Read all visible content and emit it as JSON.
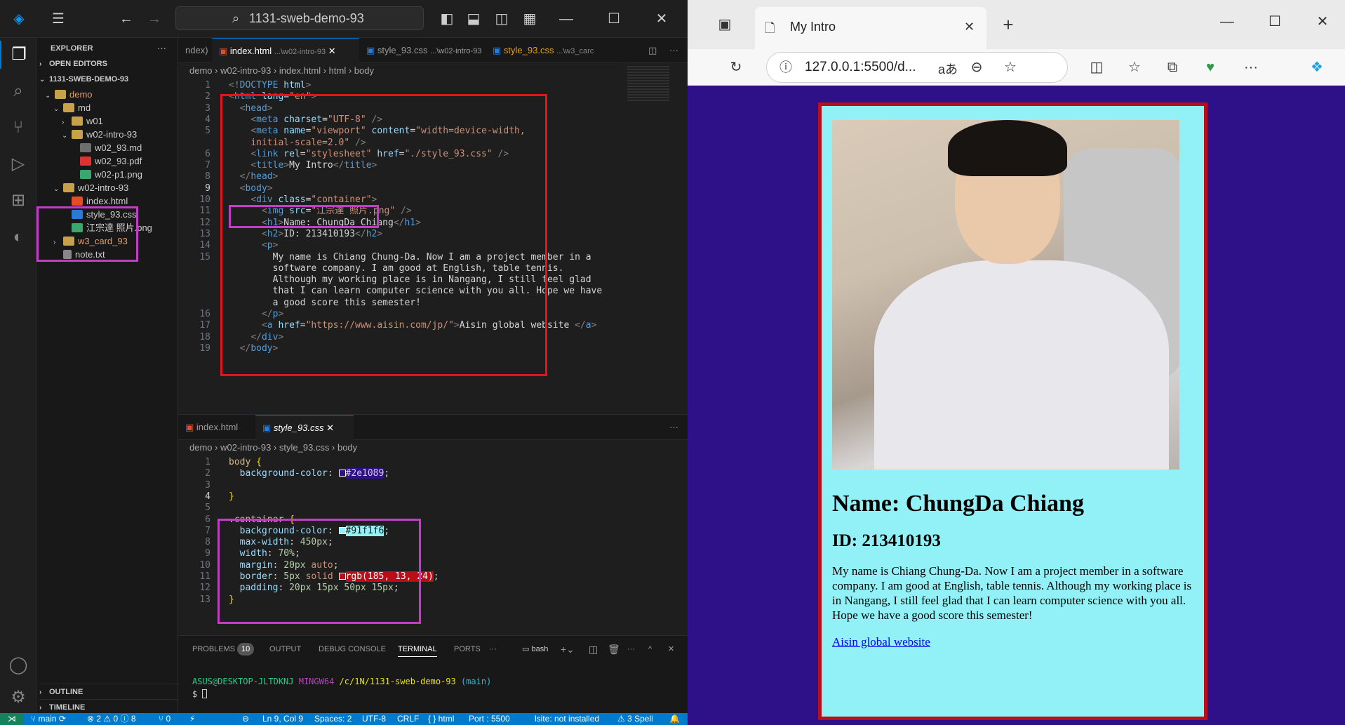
{
  "vscode": {
    "search": "1131-sweb-demo-93",
    "explorer_title": "EXPLORER",
    "open_editors": "OPEN EDITORS",
    "workspace": "1131-SWEB-DEMO-93",
    "tree": [
      {
        "label": "demo",
        "indent": 1,
        "type": "folder",
        "open": true,
        "color": "#e59b6a"
      },
      {
        "label": "md",
        "indent": 2,
        "type": "folder",
        "open": true
      },
      {
        "label": "w01",
        "indent": 3,
        "type": "folder",
        "open": false
      },
      {
        "label": "w02-intro-93",
        "indent": 3,
        "type": "folder",
        "open": true
      },
      {
        "label": "w02_93.md",
        "indent": 4,
        "type": "md"
      },
      {
        "label": "w02_93.pdf",
        "indent": 4,
        "type": "pdf"
      },
      {
        "label": "w02-p1.png",
        "indent": 4,
        "type": "png"
      },
      {
        "label": "w02-intro-93",
        "indent": 2,
        "type": "folder",
        "open": true
      },
      {
        "label": "index.html",
        "indent": 3,
        "type": "html"
      },
      {
        "label": "style_93.css",
        "indent": 3,
        "type": "css"
      },
      {
        "label": "江宗達 照片.png",
        "indent": 3,
        "type": "png"
      },
      {
        "label": "w3_card_93",
        "indent": 2,
        "type": "folder",
        "open": false,
        "color": "#e59b6a"
      },
      {
        "label": "note.txt",
        "indent": 2,
        "type": "txt"
      }
    ],
    "outline": "OUTLINE",
    "timeline": "TIMELINE",
    "editor1_tabs": [
      "ndex)",
      "index.html",
      "...\\w02-intro-93",
      "style_93.css",
      "...\\w02-intro-93",
      "style_93.css",
      "...\\w3_carc"
    ],
    "editor1_crumbs": "demo  ›  w02-intro-93  ›  index.html  ›  html  ›  body",
    "html_lines": [
      {
        "n": "1",
        "h": "<span class='g'>&lt;!</span><span class='t'>DOCTYPE</span> <span class='a'>html</span><span class='g'>&gt;</span>"
      },
      {
        "n": "2",
        "h": "<span class='g'>&lt;</span><span class='t'>html</span> <span class='a'>lang</span>=<span class='s'>\"en\"</span><span class='g'>&gt;</span>"
      },
      {
        "n": "3",
        "h": "  <span class='g'>&lt;</span><span class='t'>head</span><span class='g'>&gt;</span>"
      },
      {
        "n": "4",
        "h": "    <span class='g'>&lt;</span><span class='t'>meta</span> <span class='a'>charset</span>=<span class='s'>\"UTF-8\"</span> <span class='g'>/&gt;</span>"
      },
      {
        "n": "5",
        "h": "    <span class='g'>&lt;</span><span class='t'>meta</span> <span class='a'>name</span>=<span class='s'>\"viewport\"</span> <span class='a'>content</span>=<span class='s'>\"width=device-width,</span>"
      },
      {
        "n": "",
        "h": "    <span class='s'>initial-scale=2.0\"</span> <span class='g'>/&gt;</span>"
      },
      {
        "n": "6",
        "h": "    <span class='g'>&lt;</span><span class='t'>link</span> <span class='a'>rel</span>=<span class='s'>\"stylesheet\"</span> <span class='a'>href</span>=<span class='s'>\"./style_93.css\"</span> <span class='g'>/&gt;</span>"
      },
      {
        "n": "7",
        "h": "    <span class='g'>&lt;</span><span class='t'>title</span><span class='g'>&gt;</span>My Intro<span class='g'>&lt;/</span><span class='t'>title</span><span class='g'>&gt;</span>"
      },
      {
        "n": "8",
        "h": "  <span class='g'>&lt;/</span><span class='t'>head</span><span class='g'>&gt;</span>"
      },
      {
        "n": "9",
        "h": "  <span class='g'>&lt;</span><span class='t'>body</span><span class='g'>&gt;</span>"
      },
      {
        "n": "10",
        "h": "    <span class='g'>&lt;</span><span class='t'>div</span> <span class='a'>class</span>=<span class='s'>\"container\"</span><span class='g'>&gt;</span>"
      },
      {
        "n": "11",
        "h": "      <span class='g'>&lt;</span><span class='t'>img</span> <span class='a'>src</span>=<span class='s'>\"江宗達 照片.png\"</span> <span class='g'>/&gt;</span>"
      },
      {
        "n": "12",
        "h": "      <span class='g'>&lt;</span><span class='t'>h1</span><span class='g'>&gt;</span>Name: ChungDa Chiang<span class='g'>&lt;/</span><span class='t'>h1</span><span class='g'>&gt;</span>"
      },
      {
        "n": "13",
        "h": "      <span class='g'>&lt;</span><span class='t'>h2</span><span class='g'>&gt;</span>ID: 213410193<span class='g'>&lt;/</span><span class='t'>h2</span><span class='g'>&gt;</span>"
      },
      {
        "n": "14",
        "h": "      <span class='g'>&lt;</span><span class='t'>p</span><span class='g'>&gt;</span>"
      },
      {
        "n": "15",
        "h": "        My name is Chiang Chung-Da. Now I am a project member in a"
      },
      {
        "n": "",
        "h": "        software company. I am good at English, table tennis."
      },
      {
        "n": "",
        "h": "        Although my working place is in Nangang, I still feel glad"
      },
      {
        "n": "",
        "h": "        that I can learn computer science with you all. Hope we have"
      },
      {
        "n": "",
        "h": "        a good score this semester!"
      },
      {
        "n": "16",
        "h": "      <span class='g'>&lt;/</span><span class='t'>p</span><span class='g'>&gt;</span>"
      },
      {
        "n": "17",
        "h": "      <span class='g'>&lt;</span><span class='t'>a</span> <span class='a'>href</span>=<span class='s'>\"https://www.aisin.com/jp/\"</span><span class='g'>&gt;</span>Aisin global website <span class='g'>&lt;/</span><span class='t'>a</span><span class='g'>&gt;</span>"
      },
      {
        "n": "18",
        "h": "    <span class='g'>&lt;/</span><span class='t'>div</span><span class='g'>&gt;</span>"
      },
      {
        "n": "19",
        "h": "  <span class='g'>&lt;/</span><span class='t'>body</span><span class='g'>&gt;</span>"
      }
    ],
    "editor2_tabs": [
      "index.html",
      "style_93.css"
    ],
    "editor2_crumbs": "demo  ›  w02-intro-93  ›  style_93.css  ›  body",
    "css_lines": [
      {
        "n": "1",
        "h": "<span class='sel'>body</span> <span class='br'>{</span>"
      },
      {
        "n": "2",
        "h": "  <span class='p'>background-color</span>: <span style='display:inline-block;width:10px;height:10px;border:1px solid #fff;background:#2e1089;vertical-align:-1px'></span><span style='background:#2e1089'>#2e1089</span>;"
      },
      {
        "n": "3",
        "h": ""
      },
      {
        "n": "4",
        "h": "<span class='br'>}</span>"
      },
      {
        "n": "5",
        "h": ""
      },
      {
        "n": "6",
        "h": "<span class='sel'>.container</span> <span class='br'>{</span>"
      },
      {
        "n": "7",
        "h": "  <span class='p'>background-color</span>: <span style='display:inline-block;width:10px;height:10px;border:1px solid #fff;background:#91f1f6;vertical-align:-1px'></span><span style='background:#91f1f6;color:#1e1e1e'>#91f1f6</span>;"
      },
      {
        "n": "8",
        "h": "  <span class='p'>max-width</span>: <span class='n'>450px</span>;"
      },
      {
        "n": "9",
        "h": "  <span class='p'>width</span>: <span class='n'>70%</span>;"
      },
      {
        "n": "10",
        "h": "  <span class='p'>margin</span>: <span class='n'>20px</span> <span class='v'>auto</span>;"
      },
      {
        "n": "11",
        "h": "  <span class='p'>border</span>: <span class='n'>5px</span> <span class='v'>solid</span> <span style='display:inline-block;width:10px;height:10px;border:1px solid #fff;background:#b90d18;vertical-align:-1px'></span><span style='background:#b90d18;color:#fff'>rgb(185, 13, 24)</span>;"
      },
      {
        "n": "12",
        "h": "  <span class='p'>padding</span>: <span class='n'>20px 15px 50px 15px</span>;"
      },
      {
        "n": "13",
        "h": "<span class='br'>}</span>"
      }
    ],
    "panel_tabs": [
      "PROBLEMS",
      "10",
      "OUTPUT",
      "DEBUG CONSOLE",
      "TERMINAL",
      "PORTS"
    ],
    "terminal_shell": "bash",
    "term_user": "ASUS@DESKTOP-JLTDKNJ",
    "term_env": "MINGW64",
    "term_path": "/c/1N/1131-sweb-demo-93",
    "term_branch": "(main)",
    "term_prompt": "$",
    "status": [
      "main",
      "⊗ 2 ⚠ 0 ⓘ 8",
      "⑂ 0",
      "Ln 9, Col 9",
      "Spaces: 2",
      "UTF-8",
      "CRLF",
      "{ } html",
      "Port : 5500",
      "lsite: not installed",
      "⚠ 3 Spell"
    ]
  },
  "browser": {
    "tab_title": "My Intro",
    "url": "127.0.0.1:5500/d...",
    "read_aloud": "aあ"
  },
  "page": {
    "h1": "Name: ChungDa Chiang",
    "h2": "ID: 213410193",
    "p": "My name is Chiang Chung-Da. Now I am a project member in a software company. I am good at English, table tennis. Although my working place is in Nangang, I still feel glad that I can learn computer science with you all. Hope we have a good score this semester!",
    "link": "Aisin global website"
  },
  "colors": {
    "body_bg": "#2e1089",
    "container_bg": "#91f1f6",
    "border": "#b90d18",
    "accent": "#007acc"
  }
}
